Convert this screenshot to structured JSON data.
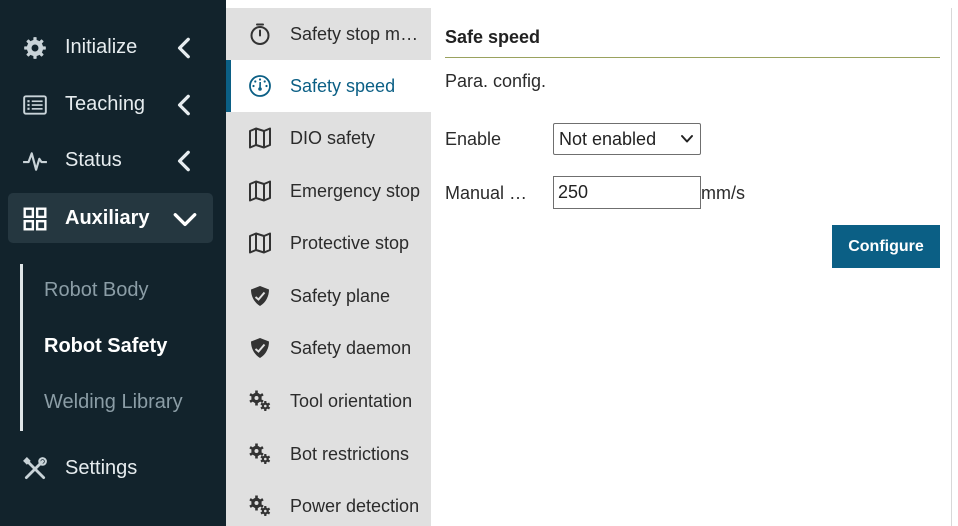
{
  "sidebar": {
    "items": [
      {
        "label": "Initialize",
        "icon": "gear-icon",
        "chevron": "chevron-left-icon"
      },
      {
        "label": "Teaching",
        "icon": "list-icon",
        "chevron": "chevron-left-icon"
      },
      {
        "label": "Status",
        "icon": "pulse-icon",
        "chevron": "chevron-left-icon"
      },
      {
        "label": "Auxiliary",
        "icon": "grid-icon",
        "chevron": "chevron-down-icon"
      },
      {
        "label": "Settings",
        "icon": "tools-icon"
      }
    ],
    "sub_items": [
      {
        "label": "Robot Body"
      },
      {
        "label": "Robot Safety"
      },
      {
        "label": "Welding Library"
      }
    ]
  },
  "menu": {
    "items": [
      {
        "label": "Safety stop mode",
        "icon": "timer-icon"
      },
      {
        "label": "Safety speed",
        "icon": "speedometer-icon"
      },
      {
        "label": "DIO safety",
        "icon": "map-icon"
      },
      {
        "label": "Emergency stop",
        "icon": "map-icon"
      },
      {
        "label": "Protective stop",
        "icon": "map-icon"
      },
      {
        "label": "Safety plane",
        "icon": "shield-check-icon"
      },
      {
        "label": "Safety daemon",
        "icon": "shield-check-icon"
      },
      {
        "label": "Tool orientation",
        "icon": "gears-icon"
      },
      {
        "label": "Bot restrictions",
        "icon": "gears-icon"
      },
      {
        "label": "Power detection",
        "icon": "gears-icon"
      }
    ]
  },
  "panel": {
    "title": "Safe speed",
    "section": "Para. config.",
    "enable_label": "Enable",
    "enable_value": "Not enabled",
    "manual_label": "Manual …",
    "manual_value": "250",
    "unit": "mm/s",
    "configure_label": "Configure"
  },
  "colors": {
    "sidebar_bg": "#12232c",
    "accent": "#0b5f85",
    "menu_bg": "#e0e0e0",
    "title_rule": "#9aa25e"
  }
}
